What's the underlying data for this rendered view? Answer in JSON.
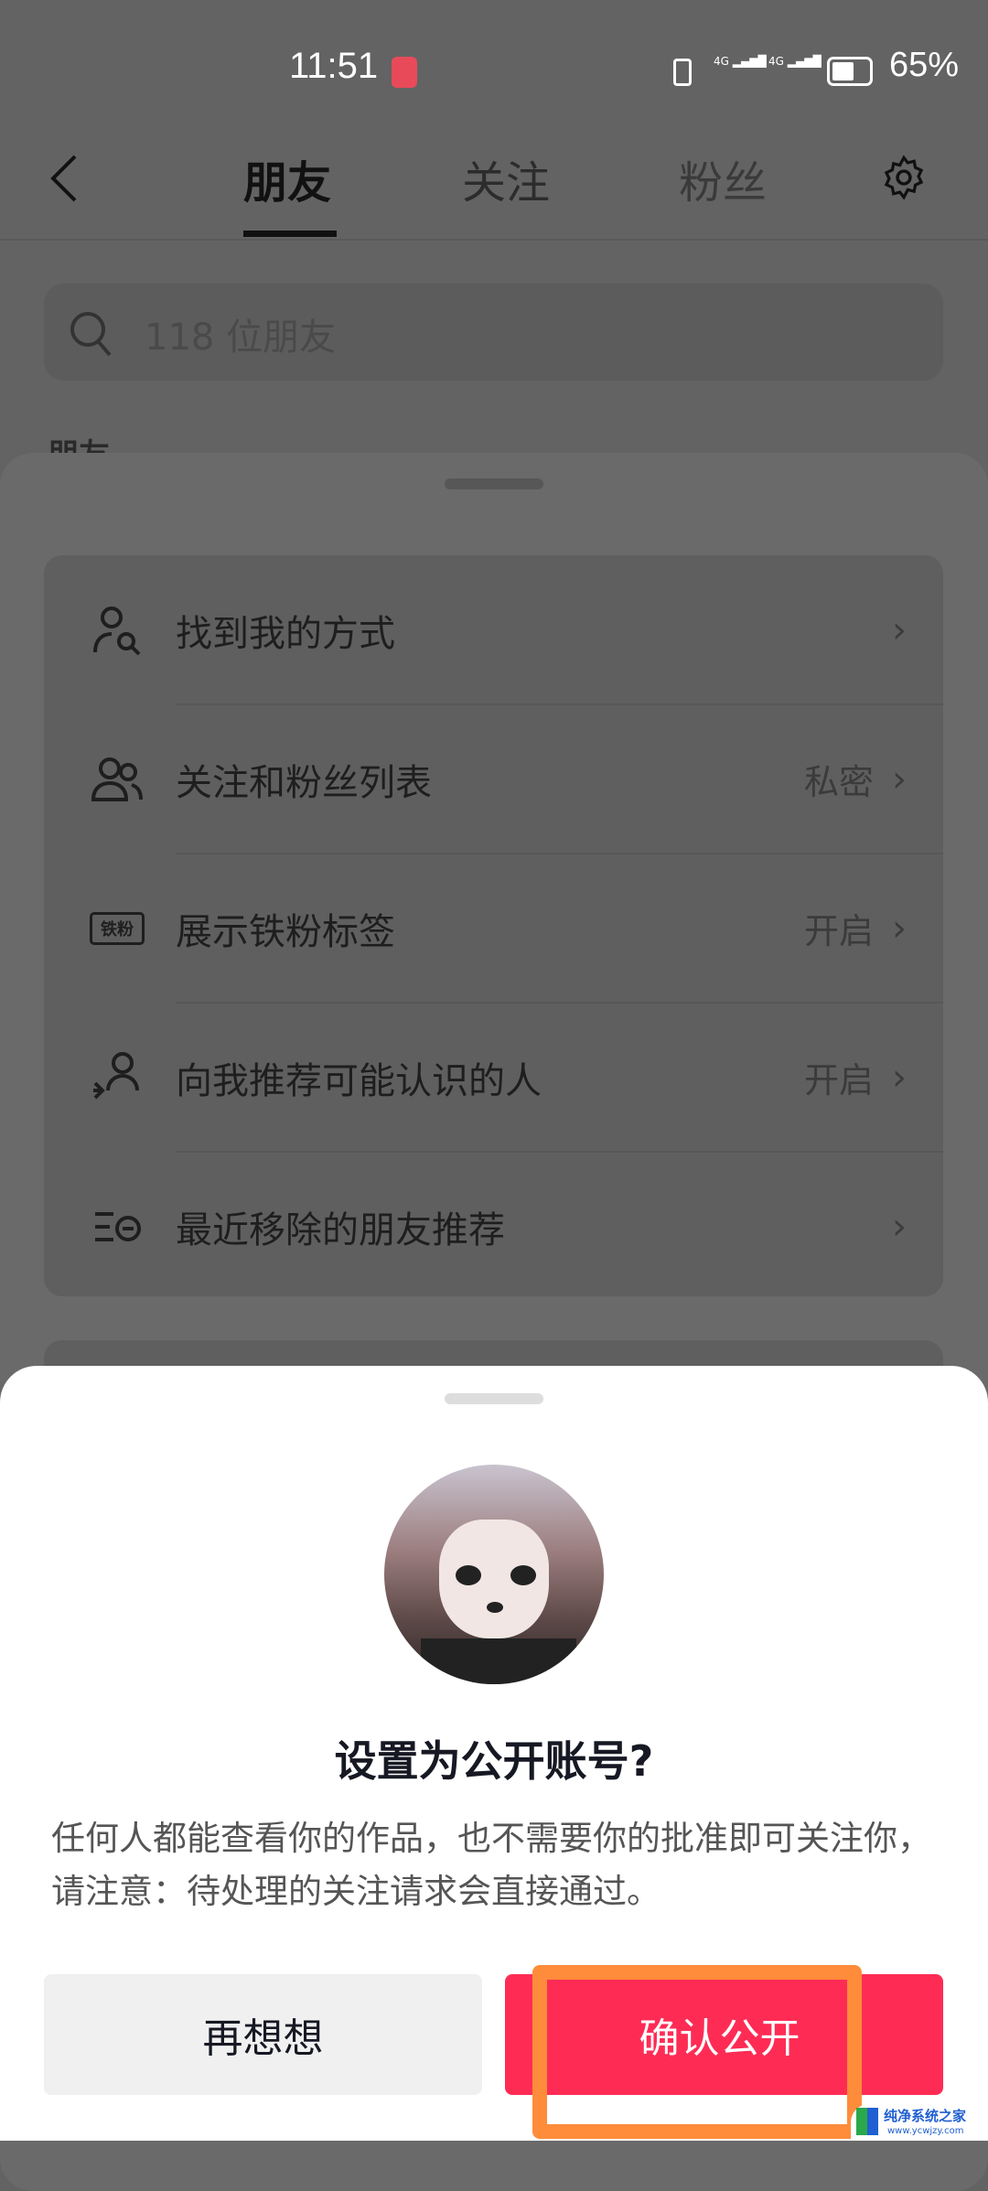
{
  "status_bar": {
    "time": "11:51",
    "battery": "65%",
    "network_1": "4G",
    "network_2": "4G"
  },
  "header": {
    "tabs": [
      {
        "label": "朋友",
        "active": true
      },
      {
        "label": "关注"
      },
      {
        "label": "粉丝"
      }
    ]
  },
  "search": {
    "placeholder": "118 位朋友"
  },
  "section_heading": "朋友",
  "settings": {
    "items": [
      {
        "label": "找到我的方式",
        "value": "",
        "icon": "person-search-icon"
      },
      {
        "label": "关注和粉丝列表",
        "value": "私密",
        "icon": "people-icon"
      },
      {
        "label": "展示铁粉标签",
        "value": "开启",
        "icon": "iron-fan-badge-icon",
        "badge": "铁粉"
      },
      {
        "label": "向我推荐可能认识的人",
        "value": "开启",
        "icon": "recommend-person-icon"
      },
      {
        "label": "最近移除的朋友推荐",
        "value": "",
        "icon": "removed-list-icon"
      }
    ]
  },
  "dialog": {
    "title": "设置为公开账号?",
    "description": "任何人都能查看你的作品，也不需要你的批准即可关注你，请注意：待处理的关注请求会直接通过。",
    "cancel": "再想想",
    "confirm": "确认公开"
  },
  "colors": {
    "accent": "#fe2c55",
    "highlight": "#ff8c3a"
  },
  "watermark": {
    "name": "纯净系统之家",
    "url": "www.ycwjzy.com"
  }
}
